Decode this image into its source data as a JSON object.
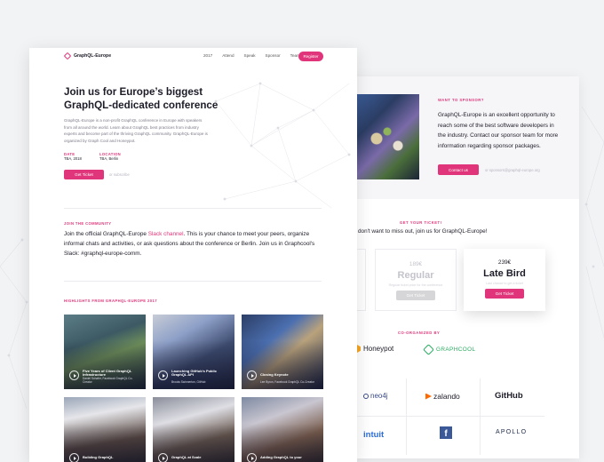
{
  "nav": {
    "brand": "GraphQL-Europe",
    "links": [
      "2017",
      "Attend",
      "Speak",
      "Sponsor",
      "Team"
    ],
    "register": "Register"
  },
  "hero": {
    "title": "Join us for Europe’s biggest GraphQL-dedicated conference",
    "lead": "GraphQL-Europe is a non-profit GraphQL conference in Europe with speakers from all around the world. Learn about GraphQL best practices from industry experts and become part of the thriving GraphQL community. GraphQL-Europe is organized by Graph Cool and Honeypot.",
    "date_label": "DATE",
    "date_value": "TBA, 2018",
    "location_label": "LOCATION",
    "location_value": "TBA, Berlin",
    "cta": "Get Ticket",
    "subnote": "or subscribe"
  },
  "community": {
    "eyebrow": "JOIN THE COMMUNITY",
    "text_before": "Join the official GraphQL-Europe ",
    "link": "Slack channel",
    "text_after": ". This is your chance to meet your peers, organize informal chats and activities, or ask questions about the conference or Berlin. Join us in Graphcool's Slack: #graphql-europe-comm."
  },
  "highlights": {
    "eyebrow": "HIGHLIGHTS FROM GRAPHQL-EUROPE 2017",
    "talks": [
      {
        "title": "Five Years of Client GraphQL Infrastructure",
        "speaker": "Daniel Schafer, Facebook GraphQL Co-Creator"
      },
      {
        "title": "Launching GitHub's Public GraphQL API",
        "speaker": "Brooks Swinnerton, GitHub"
      },
      {
        "title": "Closing Keynote",
        "speaker": "Lee Byron, Facebook GraphQL Co-Creator"
      },
      {
        "title": "Building GraphQL",
        "speaker": ""
      },
      {
        "title": "GraphQL at Scale",
        "speaker": ""
      },
      {
        "title": "Adding GraphQL to your",
        "speaker": ""
      }
    ]
  },
  "sponsor": {
    "eyebrow": "WANT TO SPONSOR?",
    "text": "GraphQL-Europe is an excellent opportunity to reach some of the best software developers in the industry. Contact our sponsor team for more information regarding sponsor packages.",
    "cta": "Contact us",
    "email": "or sponsors@graphql-europe.org"
  },
  "tickets": {
    "eyebrow": "GET YOUR TICKET!",
    "intro": "don't want to miss out, join us for GraphQL-Europe!",
    "regular": {
      "price": "189€",
      "name": "Regular",
      "note": "Regular ticket price for the conference",
      "cta": "Get Ticket"
    },
    "early": {
      "price": "239€",
      "name": "Late Bird",
      "note": "Last chance to get a ticket",
      "cta": "Get Ticket"
    }
  },
  "organizers": {
    "eyebrow": "CO-ORGANIZED BY",
    "names": [
      "Honeypot",
      "GRAPHCOOL"
    ]
  },
  "sponsors": {
    "logos": [
      "neo4j",
      "zalando",
      "GitHub",
      "intuit",
      "f",
      "APOLLO"
    ]
  },
  "colors": {
    "accent": "#e0357a",
    "graphcool": "#27ae60",
    "honeypot": "#f5a623"
  }
}
